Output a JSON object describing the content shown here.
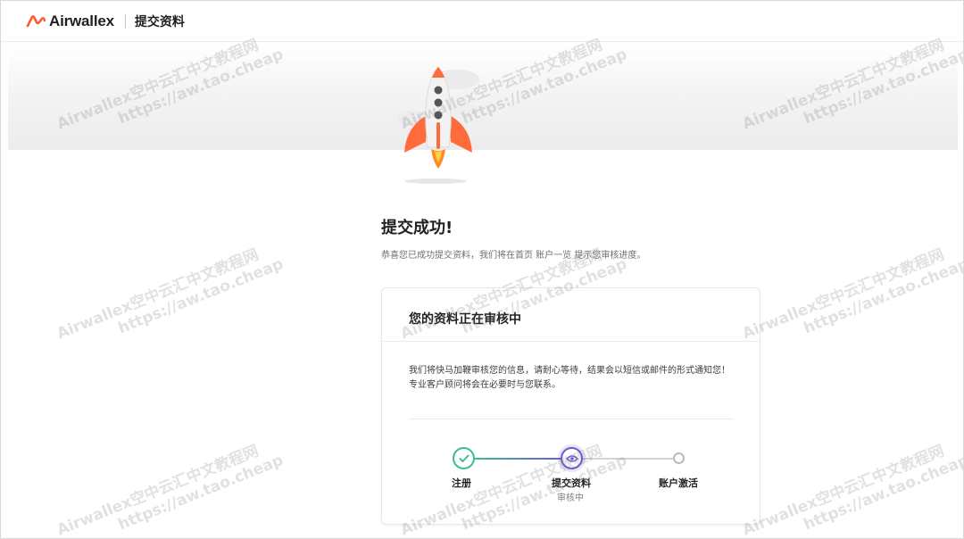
{
  "header": {
    "brand": "Airwallex",
    "page_title": "提交资料"
  },
  "main": {
    "success_title": "提交成功!",
    "success_desc": "恭喜您已成功提交资料，我们将在首页 账户一览 提示您审核进度。",
    "card": {
      "title": "您的资料正在审核中",
      "body": "我们将快马加鞭审核您的信息，请耐心等待，结果会以短信或邮件的形式通知您！专业客户顾问将会在必要时与您联系。",
      "steps": [
        {
          "label": "注册",
          "status": "done"
        },
        {
          "label": "提交资料",
          "status": "active",
          "sub": "审核中"
        },
        {
          "label": "账户激活",
          "status": "pending"
        }
      ]
    }
  },
  "watermark": {
    "line1": "Airwallex空中云汇中文教程网",
    "line2": "https://aw.tao.cheap"
  },
  "colors": {
    "brand": "#ff5a36",
    "done": "#3bbf8c",
    "active": "#6c5ad6",
    "pending": "#b9b9c0"
  },
  "icons": {
    "logo": "airwallex-logo-icon",
    "done": "check-icon",
    "active": "eye-icon",
    "hero": "rocket-illustration"
  }
}
